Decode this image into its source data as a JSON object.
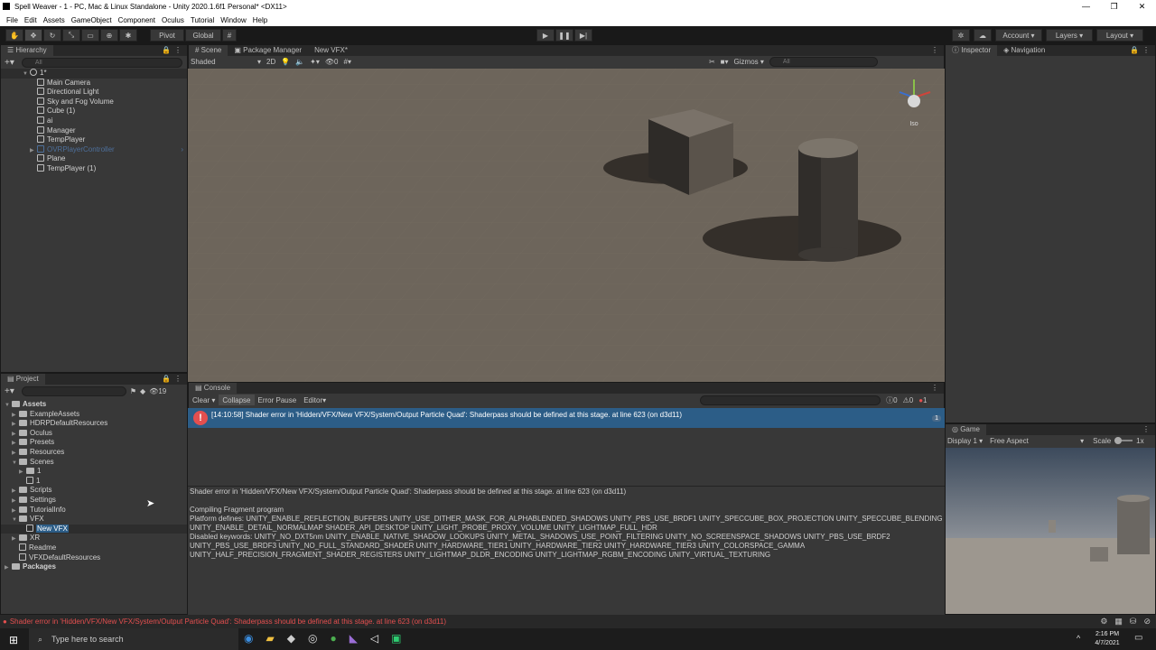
{
  "window": {
    "title": "Spell Weaver - 1 - PC, Mac & Linux Standalone - Unity 2020.1.6f1 Personal* <DX11>"
  },
  "menu": [
    "File",
    "Edit",
    "Assets",
    "GameObject",
    "Component",
    "Oculus",
    "Tutorial",
    "Window",
    "Help"
  ],
  "toolbar": {
    "pivot": "Pivot",
    "global": "Global",
    "account": "Account",
    "layers": "Layers",
    "layout": "Layout"
  },
  "hierarchy": {
    "tab": "Hierarchy",
    "search_placeholder": "All",
    "scene": "1*",
    "items": [
      "Main Camera",
      "Directional Light",
      "Sky and Fog Volume",
      "Cube (1)",
      "ai",
      "Manager",
      "TempPlayer",
      "OVRPlayerController",
      "Plane",
      "TempPlayer (1)"
    ]
  },
  "scene": {
    "tabs": [
      "Scene",
      "Package Manager",
      "New VFX*"
    ],
    "shading": "Shaded",
    "mode2d": "2D",
    "hidden_count": "0",
    "gizmos": "Gizmos",
    "search_placeholder": "All",
    "iso": "Iso"
  },
  "inspector": {
    "tabs": [
      "Inspector",
      "Navigation"
    ]
  },
  "project": {
    "tab": "Project",
    "badge": "19",
    "items": [
      {
        "label": "Assets",
        "kind": "root"
      },
      {
        "label": "ExampleAssets",
        "kind": "folder"
      },
      {
        "label": "HDRPDefaultResources",
        "kind": "folder"
      },
      {
        "label": "Oculus",
        "kind": "folder"
      },
      {
        "label": "Presets",
        "kind": "folder"
      },
      {
        "label": "Resources",
        "kind": "folder"
      },
      {
        "label": "Scenes",
        "kind": "folder"
      },
      {
        "label": "1",
        "kind": "subfolder"
      },
      {
        "label": "1",
        "kind": "subscene"
      },
      {
        "label": "Scripts",
        "kind": "folder"
      },
      {
        "label": "Settings",
        "kind": "folder"
      },
      {
        "label": "TutorialInfo",
        "kind": "folder"
      },
      {
        "label": "VFX",
        "kind": "folder"
      },
      {
        "label": "New VFX",
        "kind": "selected"
      },
      {
        "label": "XR",
        "kind": "folder"
      },
      {
        "label": "Readme",
        "kind": "file"
      },
      {
        "label": "VFXDefaultResources",
        "kind": "file"
      },
      {
        "label": "Packages",
        "kind": "root"
      }
    ]
  },
  "console": {
    "tab": "Console",
    "clear": "Clear",
    "collapse": "Collapse",
    "error_pause": "Error Pause",
    "editor": "Editor",
    "counts": {
      "log": "0",
      "warn": "0",
      "error": "1"
    },
    "entry": "[14:10:58] Shader error in 'Hidden/VFX/New VFX/System/Output Particle Quad': Shaderpass should be defined at this stage. at line 623 (on d3d11)",
    "entry_count": "1",
    "detail": [
      "Shader error in 'Hidden/VFX/New VFX/System/Output Particle Quad': Shaderpass should be defined at this stage. at line 623 (on d3d11)",
      "",
      "Compiling Fragment program",
      "Platform defines: UNITY_ENABLE_REFLECTION_BUFFERS UNITY_USE_DITHER_MASK_FOR_ALPHABLENDED_SHADOWS UNITY_PBS_USE_BRDF1 UNITY_SPECCUBE_BOX_PROJECTION UNITY_SPECCUBE_BLENDING",
      "UNITY_ENABLE_DETAIL_NORMALMAP SHADER_API_DESKTOP UNITY_LIGHT_PROBE_PROXY_VOLUME UNITY_LIGHTMAP_FULL_HDR",
      "Disabled keywords: UNITY_NO_DXT5nm UNITY_ENABLE_NATIVE_SHADOW_LOOKUPS UNITY_METAL_SHADOWS_USE_POINT_FILTERING UNITY_NO_SCREENSPACE_SHADOWS UNITY_PBS_USE_BRDF2",
      "UNITY_PBS_USE_BRDF3 UNITY_NO_FULL_STANDARD_SHADER UNITY_HARDWARE_TIER1 UNITY_HARDWARE_TIER2 UNITY_HARDWARE_TIER3 UNITY_COLORSPACE_GAMMA",
      "UNITY_HALF_PRECISION_FRAGMENT_SHADER_REGISTERS UNITY_LIGHTMAP_DLDR_ENCODING UNITY_LIGHTMAP_RGBM_ENCODING UNITY_VIRTUAL_TEXTURING"
    ]
  },
  "game": {
    "tab": "Game",
    "display": "Display 1",
    "aspect": "Free Aspect",
    "scale_label": "Scale",
    "scale_value": "1x"
  },
  "status": {
    "message": "Shader error in 'Hidden/VFX/New VFX/System/Output Particle Quad': Shaderpass should be defined at this stage. at line 623 (on d3d11)"
  },
  "taskbar": {
    "search_placeholder": "Type here to search",
    "time": "2:16 PM",
    "date": "4/7/2021"
  }
}
